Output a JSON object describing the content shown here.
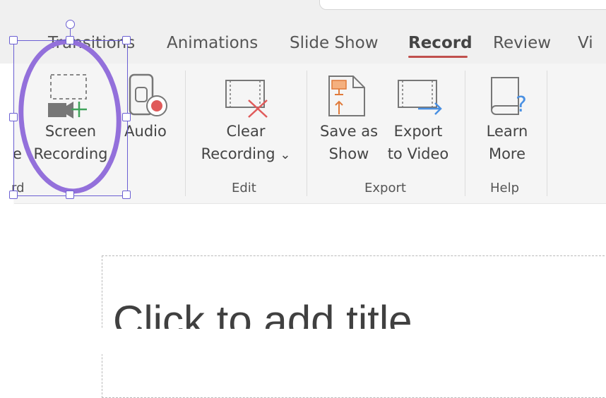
{
  "tabs": [
    {
      "label": "Transitions",
      "active": false
    },
    {
      "label": "Animations",
      "active": false
    },
    {
      "label": "Slide Show",
      "active": false
    },
    {
      "label": "Record",
      "active": true
    },
    {
      "label": "Review",
      "active": false
    },
    {
      "label": "Vi",
      "active": false
    }
  ],
  "ribbon": {
    "left_fragments": {
      "line1": "e",
      "line2": "rd"
    },
    "screen_recording": {
      "line1": "Screen",
      "line2": "Recording"
    },
    "audio": {
      "line1": "Audio"
    },
    "clear_recording": {
      "line1": "Clear",
      "line2": "Recording"
    },
    "save_as_show": {
      "line1": "Save as",
      "line2": "Show"
    },
    "export_to_video": {
      "line1": "Export",
      "line2": "to Video"
    },
    "learn_more": {
      "line1": "Learn",
      "line2": "More"
    },
    "groups": {
      "edit": "Edit",
      "export": "Export",
      "help": "Help"
    },
    "dropdown_glyph": "⌄"
  },
  "slide": {
    "title_placeholder": "Click to add title"
  },
  "colors": {
    "accent_tab": "#c0504d",
    "annotation": "#9370DB",
    "selection": "#6b5fd3",
    "record_red": "#e05a5a",
    "plus_green": "#3fa35a"
  }
}
